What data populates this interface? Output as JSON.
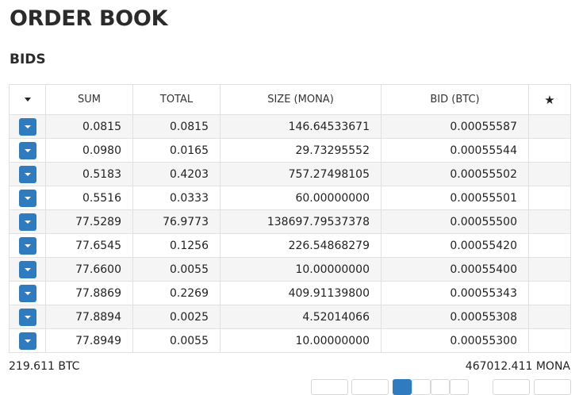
{
  "page_title": "ORDER BOOK",
  "section_title": "BIDS",
  "table": {
    "headers": {
      "sum": "SUM",
      "total": "TOTAL",
      "size": "SIZE (MONA)",
      "bid": "BID (BTC)",
      "star": "★"
    },
    "rows": [
      {
        "sum": "0.0815",
        "total": "0.0815",
        "size": "146.64533671",
        "bid": "0.00055587"
      },
      {
        "sum": "0.0980",
        "total": "0.0165",
        "size": "29.73295552",
        "bid": "0.00055544"
      },
      {
        "sum": "0.5183",
        "total": "0.4203",
        "size": "757.27498105",
        "bid": "0.00055502"
      },
      {
        "sum": "0.5516",
        "total": "0.0333",
        "size": "60.00000000",
        "bid": "0.00055501"
      },
      {
        "sum": "77.5289",
        "total": "76.9773",
        "size": "138697.79537378",
        "bid": "0.00055500"
      },
      {
        "sum": "77.6545",
        "total": "0.1256",
        "size": "226.54868279",
        "bid": "0.00055420"
      },
      {
        "sum": "77.6600",
        "total": "0.0055",
        "size": "10.00000000",
        "bid": "0.00055400"
      },
      {
        "sum": "77.8869",
        "total": "0.2269",
        "size": "409.91139800",
        "bid": "0.00055343"
      },
      {
        "sum": "77.8894",
        "total": "0.0025",
        "size": "4.52014066",
        "bid": "0.00055308"
      },
      {
        "sum": "77.8949",
        "total": "0.0055",
        "size": "10.00000000",
        "bid": "0.00055300"
      }
    ]
  },
  "footer": {
    "total_btc": "219.611 BTC",
    "total_mona": "467012.411 MONA"
  },
  "colors": {
    "accent": "#2f7bbf",
    "row_alt": "#f5f5f5"
  },
  "icons": {
    "header_sort": "caret-down-icon",
    "row_action": "chevron-down-icon",
    "favorite": "star-icon"
  }
}
